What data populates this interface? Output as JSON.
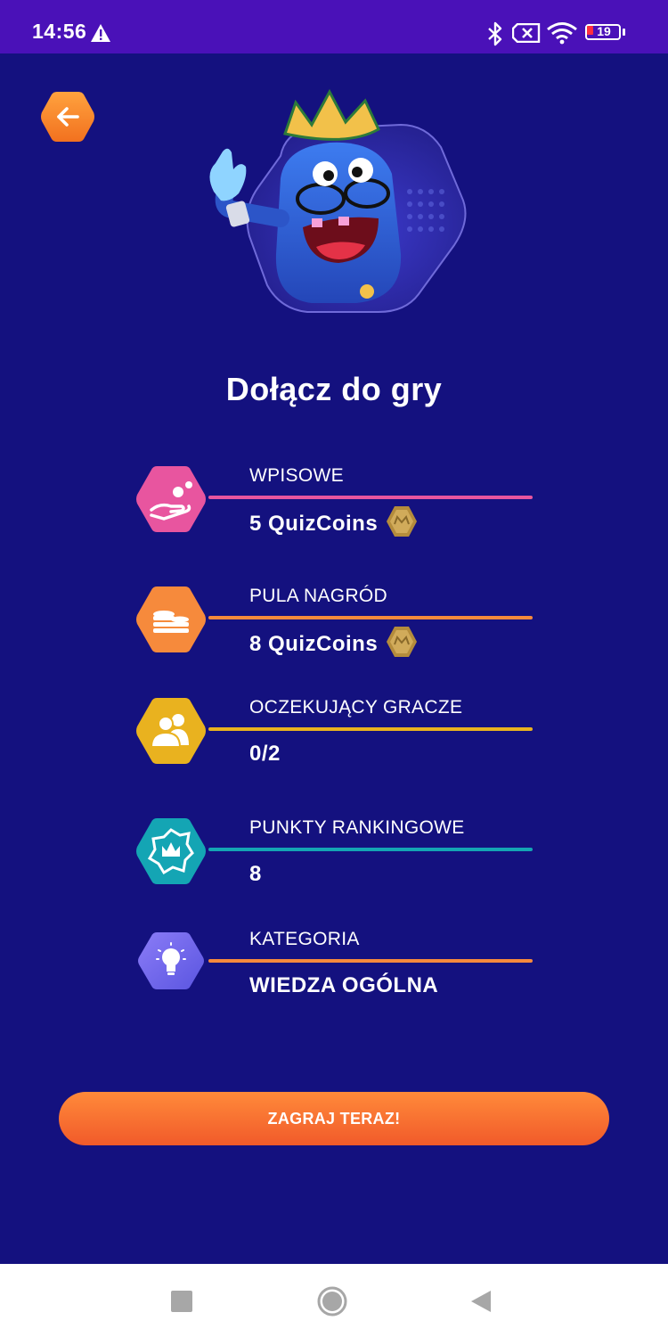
{
  "status_bar": {
    "time": "14:56",
    "battery_level": "19",
    "icons": [
      "warning-icon",
      "bluetooth-icon",
      "sim-card-off-icon",
      "wifi-icon",
      "battery-icon"
    ]
  },
  "header": {
    "back_icon": "arrow-left-icon",
    "mascot": "crowned-blue-monster-mascot"
  },
  "page_title": "Dołącz do gry",
  "rows": [
    {
      "label": "WPISOWE",
      "value": "5 QuizCoins",
      "icon": "hand-coins-icon",
      "color": "#e8559f",
      "line_color": "#e8559f",
      "coin": true
    },
    {
      "label": "PULA NAGRÓD",
      "value": "8 QuizCoins",
      "icon": "coin-stack-icon",
      "color": "#f68a3c",
      "line_color": "#f68a3c",
      "coin": true
    },
    {
      "label": "OCZEKUJĄCY GRACZE",
      "value": "0/2",
      "icon": "users-icon",
      "color": "#e9b21f",
      "line_color": "#e9b21f",
      "coin": false
    },
    {
      "label": "PUNKTY RANKINGOWE",
      "value": "8",
      "icon": "crown-badge-icon",
      "color": "#14a5b4",
      "line_color": "#14a5b4",
      "coin": false
    },
    {
      "label": "KATEGORIA",
      "value": "WIEDZA OGÓLNA",
      "icon": "lightbulb-icon",
      "color": "#7a6cf2",
      "line_color": "#f68a3c",
      "coin": false
    }
  ],
  "play_button": "ZAGRAJ TERAZ!",
  "colors": {
    "background": "#14117f",
    "status_bar": "#4a11b8",
    "accent": "#f68a3c"
  },
  "nav_bar": {
    "icons": [
      "recents-square-icon",
      "home-circle-icon",
      "back-triangle-icon"
    ]
  }
}
